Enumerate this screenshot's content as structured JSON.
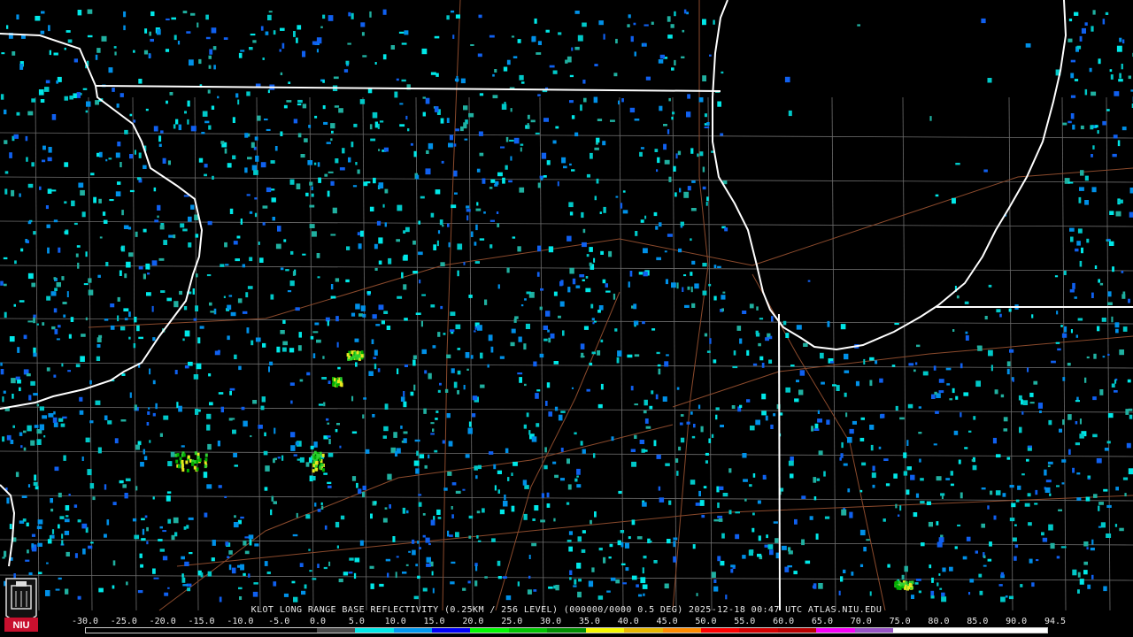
{
  "product": {
    "caption": "KLOT LONG RANGE BASE REFLECTIVITY (0.25KM / 256 LEVEL) (000000/0000 0.5 DEG) 2025-12-18 00:47 UTC  ATLAS.NIU.EDU",
    "station": "KLOT",
    "timestamp_utc": "2025-12-18 00:47 UTC",
    "source": "ATLAS.NIU.EDU"
  },
  "logo": {
    "text": "NIU",
    "icon": "niu-tower-logo-icon"
  },
  "color_scale": {
    "labels": [
      "-30.0",
      "-25.0",
      "-20.0",
      "-15.0",
      "-10.0",
      "-5.0",
      "0.0",
      "5.0",
      "10.0",
      "15.0",
      "20.0",
      "25.0",
      "30.0",
      "35.0",
      "40.0",
      "45.0",
      "50.0",
      "55.0",
      "60.0",
      "65.0",
      "70.0",
      "75.0",
      "80.0",
      "85.0",
      "90.0",
      "94.5"
    ],
    "colors": [
      "#000000",
      "#000000",
      "#000000",
      "#000000",
      "#000000",
      "#000000",
      "#4a4a4a",
      "#00e8e8",
      "#0098f0",
      "#0000f8",
      "#00fa00",
      "#00c400",
      "#008e00",
      "#f8f800",
      "#e8b800",
      "#ff8c00",
      "#ff0000",
      "#d60000",
      "#b80000",
      "#f800f8",
      "#9854c6",
      "#ffffff",
      "#ffffff",
      "#ffffff",
      "#ffffff"
    ]
  },
  "map_style": {
    "background": "#000000",
    "state_border_color": "#ffffff",
    "county_line_color": "#6e6e6e",
    "highway_color": "#8b4a2c",
    "echo_colors": [
      "#00c8c8",
      "#0090e8",
      "#00e8e8",
      "#1060f0",
      "#20b0a0"
    ],
    "strong_echo_colors": [
      "#30d030",
      "#e8e820",
      "#00b000"
    ]
  }
}
